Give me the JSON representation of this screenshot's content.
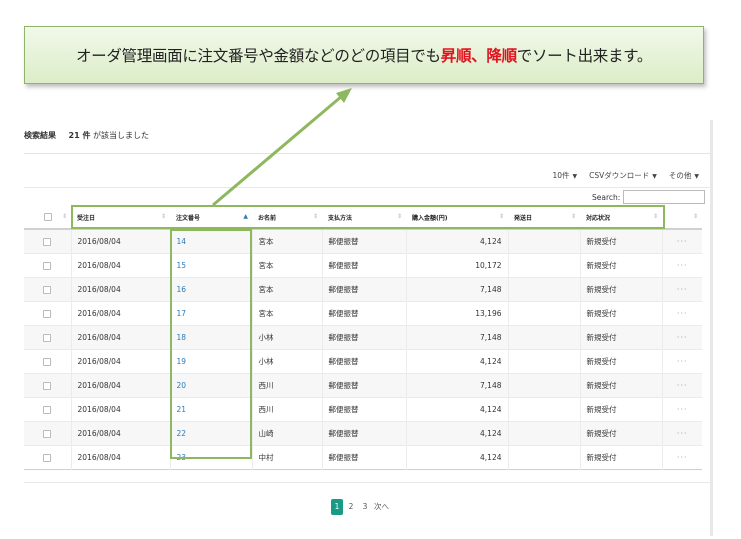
{
  "callout": {
    "prefix": "オーダ管理画面に注文番号や金額などのどの項目でも",
    "asc": "昇順",
    "comma": "、",
    "desc": "降順",
    "suffix": "でソート出来ます。"
  },
  "result": {
    "label": "検索結果",
    "count": "21 件",
    "suffix": "が該当しました"
  },
  "toolbar": {
    "per_page": "10件",
    "csv": "CSVダウンロード",
    "other": "その他"
  },
  "search": {
    "label": "Search:",
    "value": ""
  },
  "table": {
    "headers": [
      "受注日",
      "注文番号",
      "お名前",
      "支払方法",
      "購入金額(円)",
      "発送日",
      "対応状況"
    ],
    "rows": [
      {
        "date": "2016/08/04",
        "order": "14",
        "name": "宮本",
        "payment": "郵便振替",
        "amount": "4,124",
        "ship": "",
        "status": "新規受付",
        "more": "···"
      },
      {
        "date": "2016/08/04",
        "order": "15",
        "name": "宮本",
        "payment": "郵便振替",
        "amount": "10,172",
        "ship": "",
        "status": "新規受付",
        "more": "···"
      },
      {
        "date": "2016/08/04",
        "order": "16",
        "name": "宮本",
        "payment": "郵便振替",
        "amount": "7,148",
        "ship": "",
        "status": "新規受付",
        "more": "···"
      },
      {
        "date": "2016/08/04",
        "order": "17",
        "name": "宮本",
        "payment": "郵便振替",
        "amount": "13,196",
        "ship": "",
        "status": "新規受付",
        "more": "···"
      },
      {
        "date": "2016/08/04",
        "order": "18",
        "name": "小林",
        "payment": "郵便振替",
        "amount": "7,148",
        "ship": "",
        "status": "新規受付",
        "more": "···"
      },
      {
        "date": "2016/08/04",
        "order": "19",
        "name": "小林",
        "payment": "郵便振替",
        "amount": "4,124",
        "ship": "",
        "status": "新規受付",
        "more": "···"
      },
      {
        "date": "2016/08/04",
        "order": "20",
        "name": "西川",
        "payment": "郵便振替",
        "amount": "7,148",
        "ship": "",
        "status": "新規受付",
        "more": "···"
      },
      {
        "date": "2016/08/04",
        "order": "21",
        "name": "西川",
        "payment": "郵便振替",
        "amount": "4,124",
        "ship": "",
        "status": "新規受付",
        "more": "···"
      },
      {
        "date": "2016/08/04",
        "order": "22",
        "name": "山崎",
        "payment": "郵便振替",
        "amount": "4,124",
        "ship": "",
        "status": "新規受付",
        "more": "···"
      },
      {
        "date": "2016/08/04",
        "order": "23",
        "name": "中村",
        "payment": "郵便振替",
        "amount": "4,124",
        "ship": "",
        "status": "新規受付",
        "more": "···"
      }
    ]
  },
  "pagination": {
    "pages": [
      "1",
      "2",
      "3"
    ],
    "next": "次へ",
    "current": "1"
  },
  "icons": {
    "sort": "sort-arrows-icon",
    "sort_asc": "sort-asc-icon",
    "chevron": "chevron-down-icon",
    "more": "ellipsis-icon"
  },
  "colors": {
    "highlight": "#e0141e",
    "annotation": "#8db85e",
    "link": "#2a7bb8",
    "pager_active": "#1a9a85"
  }
}
